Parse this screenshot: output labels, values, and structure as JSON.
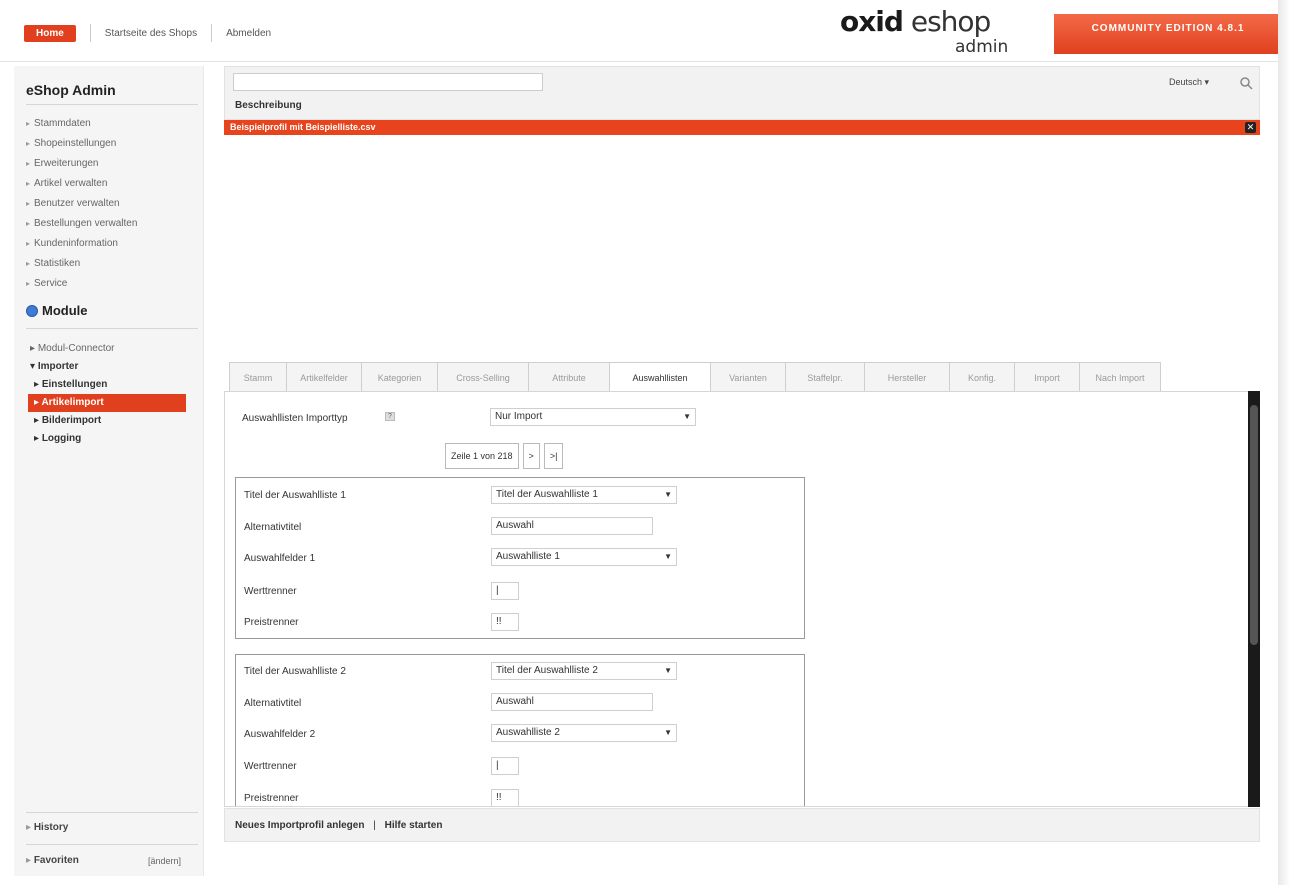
{
  "header": {
    "home_label": "Home",
    "shop_start_label": "Startseite des Shops",
    "logout_label": "Abmelden",
    "logo_main": "oxid",
    "logo_sub": "eshop",
    "logo_admin": "admin",
    "edition_label": "COMMUNITY EDITION 4.8.1"
  },
  "sidebar": {
    "title": "eShop Admin",
    "items": [
      {
        "label": "Stammdaten"
      },
      {
        "label": "Shopeinstellungen"
      },
      {
        "label": "Erweiterungen"
      },
      {
        "label": "Artikel verwalten"
      },
      {
        "label": "Benutzer verwalten"
      },
      {
        "label": "Bestellungen verwalten"
      },
      {
        "label": "Kundeninformation"
      },
      {
        "label": "Statistiken"
      },
      {
        "label": "Service"
      }
    ],
    "module_title": "Module",
    "module_items": [
      {
        "label": "Modul-Connector"
      },
      {
        "label": "Importer"
      },
      {
        "label": "Einstellungen"
      },
      {
        "label": "Artikelimport"
      },
      {
        "label": "Bilderimport"
      },
      {
        "label": "Logging"
      }
    ],
    "history_label": "History",
    "favorites_label": "Favoriten",
    "favorites_edit": "[ändern]"
  },
  "toppanel": {
    "search_value": "",
    "column_header": "Beschreibung",
    "language_label": "Deutsch",
    "selected_row": "Beispielprofil mit Beispielliste.csv"
  },
  "tabs": [
    {
      "label": "Stamm"
    },
    {
      "label": "Artikelfelder"
    },
    {
      "label": "Kategorien"
    },
    {
      "label": "Cross-Selling"
    },
    {
      "label": "Attribute"
    },
    {
      "label": "Auswahllisten"
    },
    {
      "label": "Varianten"
    },
    {
      "label": "Staffelpr."
    },
    {
      "label": "Hersteller"
    },
    {
      "label": "Konfig."
    },
    {
      "label": "Import"
    },
    {
      "label": "Nach Import"
    }
  ],
  "content": {
    "import_type_label": "Auswahllisten Importtyp",
    "import_type_value": "Nur Import",
    "pager_text": "Zeile 1 von 218",
    "pager_next": ">",
    "pager_last": ">|",
    "group1": {
      "title_label": "Titel der Auswahlliste 1",
      "title_value": "Titel der Auswahlliste 1",
      "alt_label": "Alternativtitel",
      "alt_value": "Auswahl",
      "fields_label": "Auswahlfelder 1",
      "fields_value": "Auswahlliste 1",
      "value_sep_label": "Werttrenner",
      "value_sep_value": "|",
      "price_sep_label": "Preistrenner",
      "price_sep_value": "!!"
    },
    "group2": {
      "title_label": "Titel der Auswahlliste 2",
      "title_value": "Titel der Auswahlliste 2",
      "alt_label": "Alternativtitel",
      "alt_value": "Auswahl",
      "fields_label": "Auswahlfelder 2",
      "fields_value": "Auswahlliste 2",
      "value_sep_label": "Werttrenner",
      "value_sep_value": "|",
      "price_sep_label": "Preistrenner",
      "price_sep_value": "!!"
    }
  },
  "bottombar": {
    "new_profile": "Neues Importprofil anlegen",
    "separator": "|",
    "help": "Hilfe starten"
  },
  "colors": {
    "accent": "#e0401d",
    "edition_bg": "#f36a48"
  }
}
